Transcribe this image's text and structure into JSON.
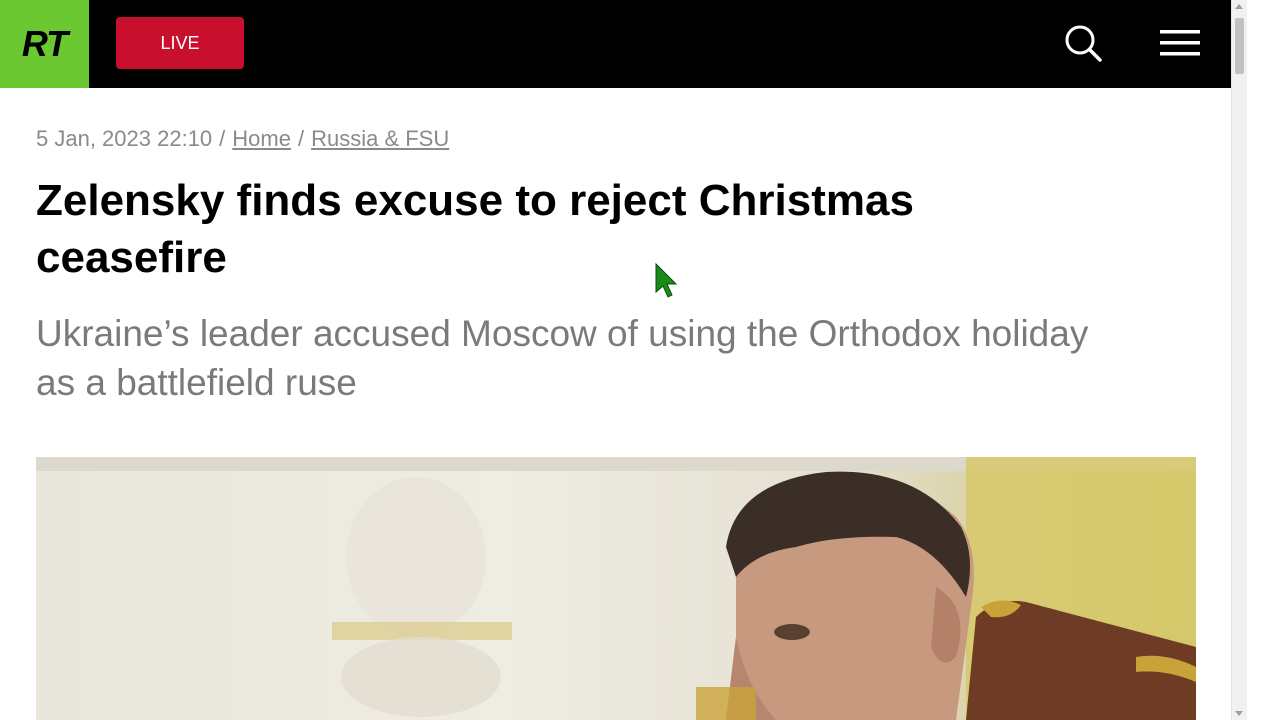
{
  "header": {
    "logo_text": "RT",
    "live_label": "LIVE",
    "colors": {
      "bar": "#000000",
      "logo_bg": "#6bc830",
      "live_bg": "#c8102e"
    },
    "icons": [
      "search-icon",
      "hamburger-menu-icon"
    ]
  },
  "article": {
    "date": "5 Jan, 2023 22:10",
    "breadcrumb_separator": "/",
    "breadcrumbs": [
      "Home",
      "Russia & FSU"
    ],
    "title": "Zelensky finds excuse to reject Christmas ceasefire",
    "summary": "Ukraine’s leader accused Moscow of using the Orthodox holiday as a battlefield ruse"
  }
}
